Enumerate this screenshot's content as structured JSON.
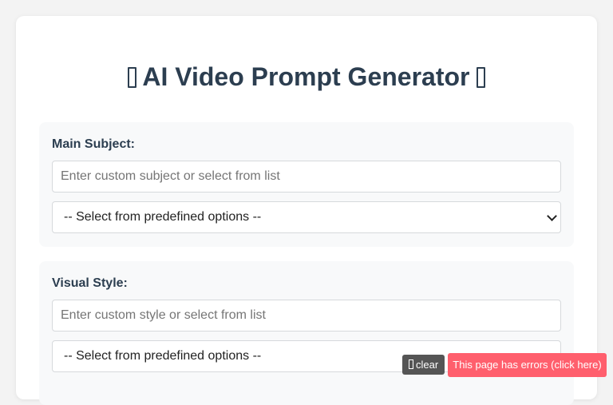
{
  "header": {
    "title": "AI Video Prompt Generator",
    "leading_icon": "missing-glyph",
    "trailing_icon": "missing-glyph"
  },
  "sections": [
    {
      "label": "Main Subject:",
      "input_placeholder": "Enter custom subject or select from list",
      "input_value": "",
      "select_value": "-- Select from predefined options --"
    },
    {
      "label": "Visual Style:",
      "input_placeholder": "Enter custom style or select from list",
      "input_value": "",
      "select_value": "-- Select from predefined options --"
    }
  ],
  "overlay": {
    "clear_label": "clear",
    "clear_icon": "missing-glyph",
    "error_label": "This page has errors (click here)"
  },
  "colors": {
    "page_bg": "#f3f3f3",
    "title": "#2c3e50",
    "section_bg": "#f8f9fa",
    "clear_bg": "#555555",
    "error_bg": "#ff5f6d"
  }
}
